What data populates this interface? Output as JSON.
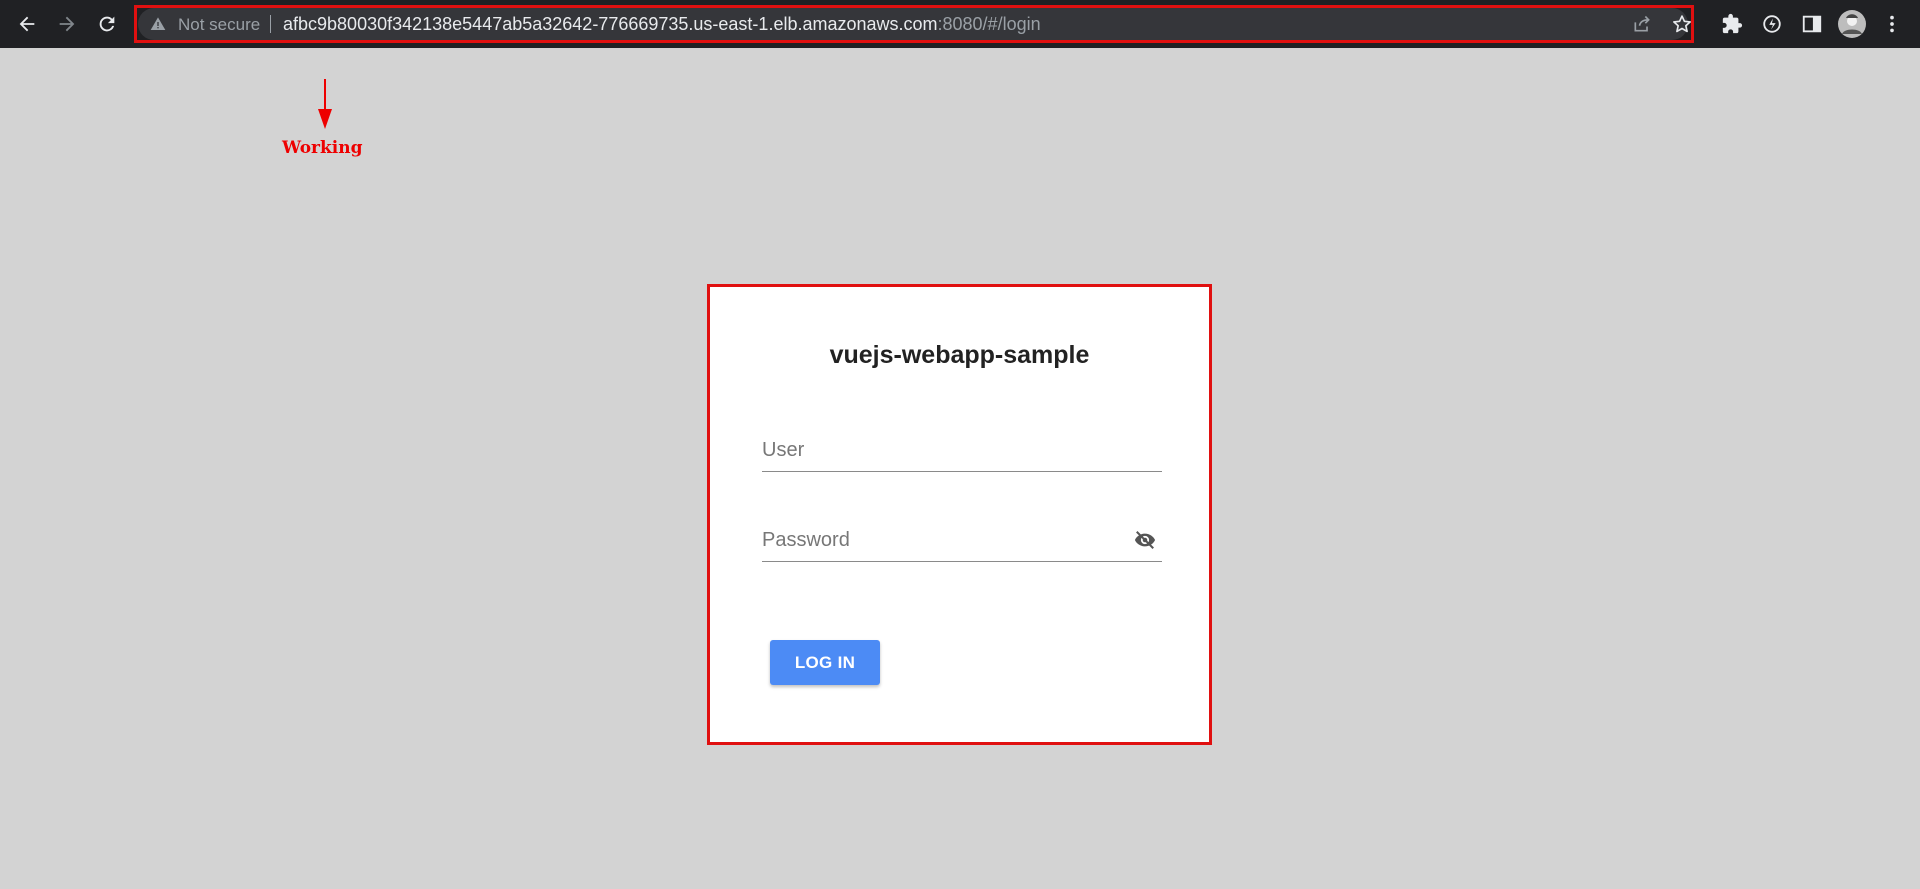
{
  "browser": {
    "security_label": "Not secure",
    "url_host": "afbc9b80030f342138e5447ab5a32642-776669735.us-east-1.elb.amazonaws.com",
    "url_rest": ":8080/#/login",
    "icons": [
      "back-icon",
      "forward-icon",
      "reload-icon",
      "warning-icon",
      "share-icon",
      "star-icon",
      "extensions-icon",
      "sync-icon",
      "side-panel-icon",
      "avatar",
      "menu-icon"
    ]
  },
  "annotation": {
    "label": "Working",
    "color": "#ee0000"
  },
  "login": {
    "title": "vuejs-webapp-sample",
    "user_placeholder": "User",
    "password_placeholder": "Password",
    "button_label": "LOG IN",
    "accent_color": "#4c8bf5"
  }
}
